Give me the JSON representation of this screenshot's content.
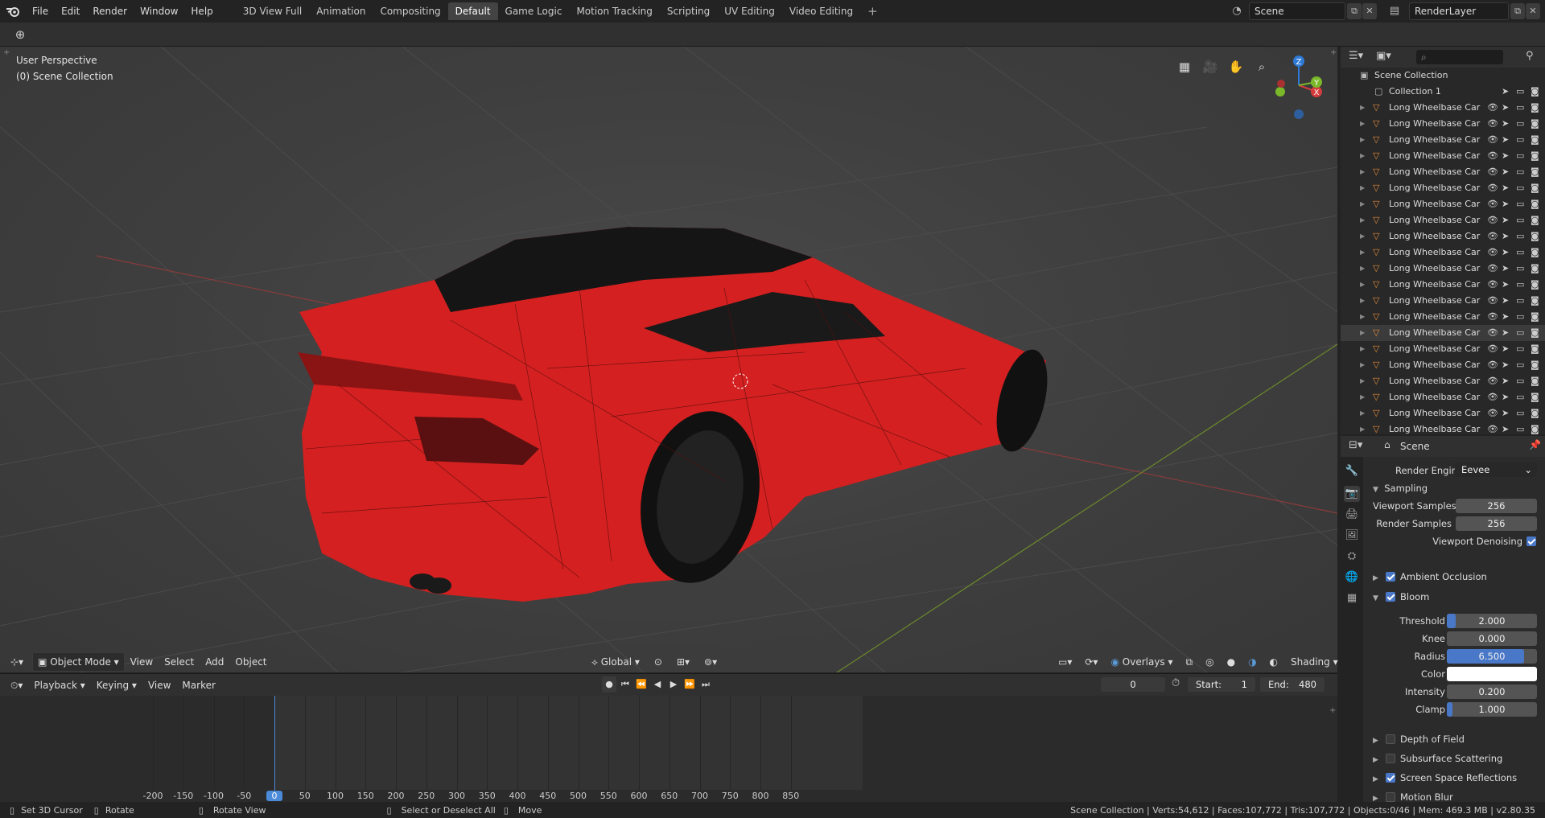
{
  "topbar": {
    "menu": [
      "File",
      "Edit",
      "Render",
      "Window",
      "Help"
    ],
    "workspaces": [
      "3D View Full",
      "Animation",
      "Compositing",
      "Default",
      "Game Logic",
      "Motion Tracking",
      "Scripting",
      "UV Editing",
      "Video Editing"
    ],
    "active_workspace": "Default",
    "add_workspace": "+",
    "scene_name": "Scene",
    "view_layer": "RenderLayer"
  },
  "viewport": {
    "perspective_label": "User Perspective",
    "collection_label": "(0) Scene Collection",
    "gizmo": {
      "z": "Z",
      "y": "Y",
      "x": "X"
    },
    "header": {
      "mode": "Object Mode",
      "menus": [
        "View",
        "Select",
        "Add",
        "Object"
      ],
      "orientation": "Global",
      "overlays": "Overlays",
      "shading": "Shading"
    }
  },
  "timeline": {
    "menus": [
      "Playback",
      "Keying",
      "View",
      "Marker"
    ],
    "current_frame": "0",
    "start_label": "Start:",
    "start": "1",
    "end_label": "End:",
    "end": "480",
    "ticks": [
      "-200",
      "-150",
      "-100",
      "-50",
      "0",
      "50",
      "100",
      "150",
      "200",
      "250",
      "300",
      "350",
      "400",
      "450",
      "500",
      "550",
      "600",
      "650",
      "700",
      "750",
      "800",
      "850"
    ],
    "playhead_frame": 0
  },
  "outliner": {
    "root": "Scene Collection",
    "collection": "Collection 1",
    "object_name": "Long Wheelbase Car",
    "object_count_visible": 21,
    "selected_index": 14
  },
  "properties": {
    "context": "Scene",
    "render_engine_label": "Render Engine",
    "render_engine": "Eevee",
    "sampling": {
      "title": "Sampling",
      "viewport_samples_label": "Viewport Samples",
      "viewport_samples": "256",
      "render_samples_label": "Render Samples",
      "render_samples": "256",
      "viewport_denoising_label": "Viewport Denoising",
      "viewport_denoising": true
    },
    "ambient_occlusion": {
      "label": "Ambient Occlusion",
      "enabled": true
    },
    "bloom": {
      "label": "Bloom",
      "enabled": true,
      "threshold_label": "Threshold",
      "threshold": "2.000",
      "threshold_fill": 0.1,
      "knee_label": "Knee",
      "knee": "0.000",
      "knee_fill": 0,
      "radius_label": "Radius",
      "radius": "6.500",
      "radius_fill": 0.86,
      "color_label": "Color",
      "color": "#ffffff",
      "intensity_label": "Intensity",
      "intensity": "0.200",
      "intensity_fill": 0,
      "clamp_label": "Clamp",
      "clamp": "1.000",
      "clamp_fill": 0.04
    },
    "depth_of_field": {
      "label": "Depth of Field",
      "enabled": false
    },
    "subsurface_scattering": {
      "label": "Subsurface Scattering",
      "enabled": false
    },
    "screen_space_reflections": {
      "label": "Screen Space Reflections",
      "enabled": true
    },
    "motion_blur": {
      "label": "Motion Blur",
      "enabled": false
    }
  },
  "statusbar": {
    "set_cursor": "Set 3D Cursor",
    "rotate": "Rotate",
    "rotate_view": "Rotate View",
    "select_all": "Select or Deselect All",
    "move": "Move",
    "stats": "Scene Collection | Verts:54,612 | Faces:107,772 | Tris:107,772 | Objects:0/46 | Mem: 469.3 MB | v2.80.35"
  },
  "colors": {
    "car_body": "#d42020",
    "accent": "#4a78c8",
    "active_tab": "#434343"
  }
}
